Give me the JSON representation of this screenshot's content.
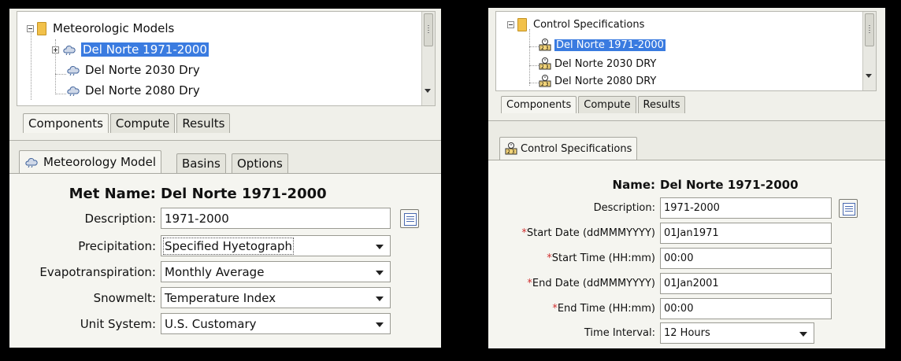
{
  "left": {
    "tree": {
      "root_label": "Meteorologic Models",
      "items": [
        "Del Norte 1971-2000",
        "Del Norte 2030 Dry",
        "Del Norte 2080 Dry"
      ],
      "selected_index": 0
    },
    "tabs": [
      "Components",
      "Compute",
      "Results"
    ],
    "subtabs": [
      "Meteorology Model",
      "Basins",
      "Options"
    ],
    "form": {
      "name_label": "Met Name:",
      "name_value": "Del Norte 1971-2000",
      "description_label": "Description:",
      "description_value": "1971-2000",
      "precipitation_label": "Precipitation:",
      "precipitation_value": "Specified Hyetograph",
      "evapotranspiration_label": "Evapotranspiration:",
      "evapotranspiration_value": "Monthly Average",
      "snowmelt_label": "Snowmelt:",
      "snowmelt_value": "Temperature Index",
      "unit_system_label": "Unit System:",
      "unit_system_value": "U.S. Customary"
    }
  },
  "right": {
    "tree": {
      "root_label": "Control Specifications",
      "items": [
        "Del Norte 1971-2000",
        "Del Norte 2030 DRY",
        "Del Norte 2080 DRY"
      ],
      "selected_index": 0
    },
    "tabs": [
      "Components",
      "Compute",
      "Results"
    ],
    "subtab": "Control Specifications",
    "form": {
      "name_label": "Name:",
      "name_value": "Del Norte 1971-2000",
      "description_label": "Description:",
      "description_value": "1971-2000",
      "required_marker": "*",
      "start_date_label": "Start Date (ddMMMYYYY)",
      "start_date_value": "01Jan1971",
      "start_time_label": "Start Time (HH:mm)",
      "start_time_value": "00:00",
      "end_date_label": "End Date (ddMMMYYYY)",
      "end_date_value": "01Jan2001",
      "end_time_label": "End Time (HH:mm)",
      "end_time_value": "00:00",
      "time_interval_label": "Time Interval:",
      "time_interval_value": "12 Hours"
    }
  },
  "icons": {
    "folder": "folder-icon",
    "met_model": "cloud-icon",
    "control_spec": "control-spec-icon",
    "description_editor": "edit-description-icon"
  },
  "colors": {
    "selection": "#3a7be0",
    "required": "#d03030",
    "folder": "#f2c14a"
  }
}
